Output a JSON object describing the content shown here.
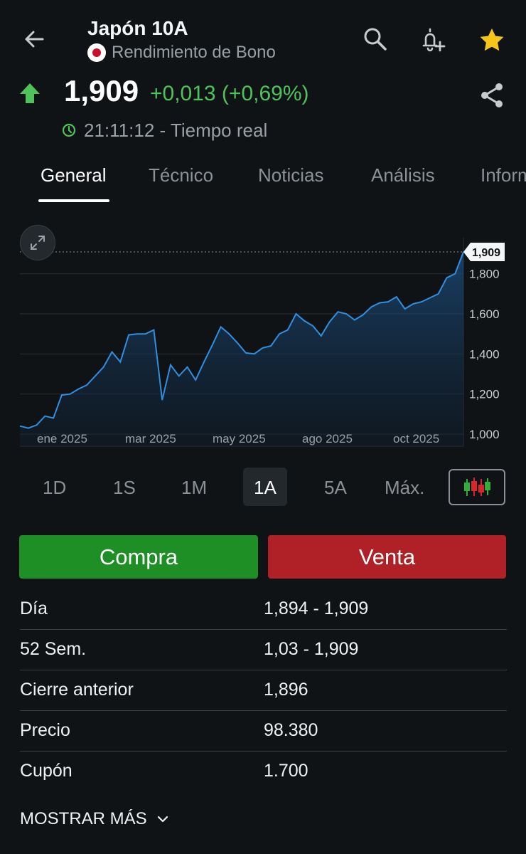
{
  "header": {
    "title": "Japón 10A",
    "subtitle": "Rendimiento de Bono",
    "price": "1,909",
    "change": "+0,013 (+0,69%)",
    "time": "21:11:12 - Tiempo real",
    "accent_up": "#4fc35a",
    "star_color": "#f5c518",
    "icons": [
      "back-arrow-icon",
      "search-icon",
      "add-alert-icon",
      "star-icon",
      "up-arrow-icon",
      "share-icon",
      "clock-icon",
      "flag-japan-icon"
    ]
  },
  "tabs": [
    {
      "label": "General",
      "active": true
    },
    {
      "label": "Técnico",
      "active": false
    },
    {
      "label": "Noticias",
      "active": false
    },
    {
      "label": "Análisis",
      "active": false
    },
    {
      "label": "Informe",
      "active": false
    }
  ],
  "chart_data": {
    "type": "area",
    "x_tick_labels": [
      "ene 2025",
      "mar 2025",
      "may 2025",
      "ago 2025",
      "oct 2025"
    ],
    "y_tick_labels": [
      "1,800",
      "1,600",
      "1,400",
      "1,200",
      "1,000"
    ],
    "ylim": [
      1000,
      1909
    ],
    "y_ticks": [
      1800,
      1600,
      1400,
      1200,
      1000
    ],
    "last_value_label": "1,909",
    "last_value": 1909,
    "line_color": "#2f8fe0",
    "grid": true,
    "values": [
      1040,
      1030,
      1045,
      1090,
      1080,
      1195,
      1200,
      1225,
      1245,
      1290,
      1335,
      1410,
      1360,
      1495,
      1500,
      1500,
      1520,
      1170,
      1345,
      1290,
      1335,
      1270,
      1360,
      1445,
      1535,
      1500,
      1455,
      1405,
      1400,
      1430,
      1440,
      1500,
      1520,
      1600,
      1565,
      1540,
      1490,
      1560,
      1610,
      1600,
      1570,
      1595,
      1635,
      1655,
      1660,
      1685,
      1625,
      1650,
      1660,
      1680,
      1700,
      1780,
      1800,
      1909
    ]
  },
  "ranges": [
    {
      "label": "1D",
      "active": false
    },
    {
      "label": "1S",
      "active": false
    },
    {
      "label": "1M",
      "active": false
    },
    {
      "label": "1A",
      "active": true
    },
    {
      "label": "5A",
      "active": false
    },
    {
      "label": "Máx.",
      "active": false
    }
  ],
  "actions": {
    "buy": "Compra",
    "sell": "Venta",
    "buy_color": "#1e8f24",
    "sell_color": "#b02127"
  },
  "stats": [
    {
      "label": "Día",
      "value": "1,894 - 1,909"
    },
    {
      "label": "52 Sem.",
      "value": "1,03 - 1,909"
    },
    {
      "label": "Cierre anterior",
      "value": "1,896"
    },
    {
      "label": "Precio",
      "value": "98.380"
    },
    {
      "label": "Cupón",
      "value": "1.700"
    }
  ],
  "show_more": "MOSTRAR MÁS"
}
